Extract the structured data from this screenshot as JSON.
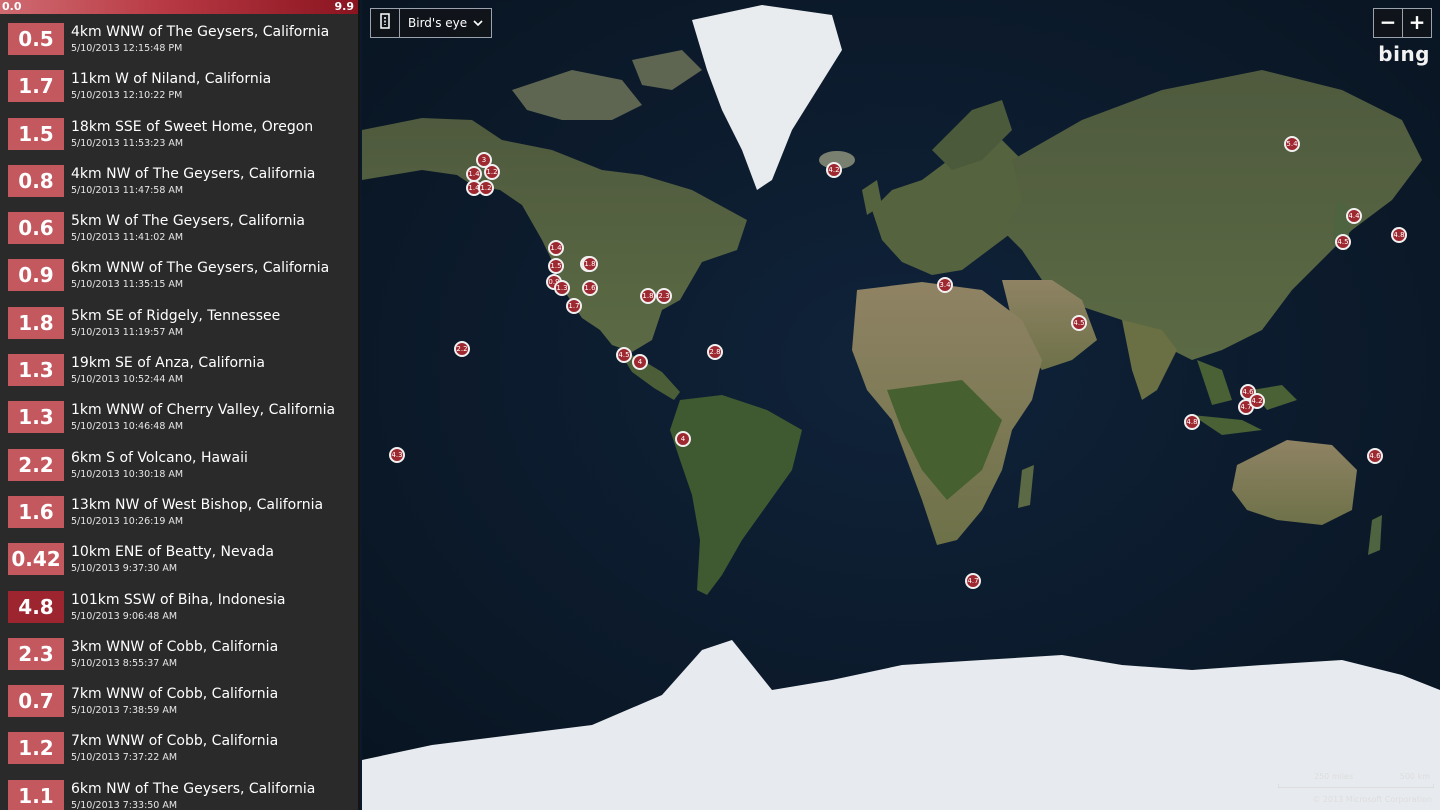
{
  "scale": {
    "min_label": "0.0",
    "max_label": "9.9",
    "colors": [
      "#d06b72",
      "#8a1420"
    ]
  },
  "quakes": [
    {
      "mag": "0.5",
      "place": "4km WNW of The Geysers, California",
      "time": "5/10/2013 12:15:48 PM"
    },
    {
      "mag": "1.7",
      "place": "11km W of Niland, California",
      "time": "5/10/2013 12:10:22 PM"
    },
    {
      "mag": "1.5",
      "place": "18km SSE of Sweet Home, Oregon",
      "time": "5/10/2013 11:53:23 AM"
    },
    {
      "mag": "0.8",
      "place": "4km NW of The Geysers, California",
      "time": "5/10/2013 11:47:58 AM"
    },
    {
      "mag": "0.6",
      "place": "5km W of The Geysers, California",
      "time": "5/10/2013 11:41:02 AM"
    },
    {
      "mag": "0.9",
      "place": "6km WNW of The Geysers, California",
      "time": "5/10/2013 11:35:15 AM"
    },
    {
      "mag": "1.8",
      "place": "5km SE of Ridgely, Tennessee",
      "time": "5/10/2013 11:19:57 AM"
    },
    {
      "mag": "1.3",
      "place": "19km SE of Anza, California",
      "time": "5/10/2013 10:52:44 AM"
    },
    {
      "mag": "1.3",
      "place": "1km WNW of Cherry Valley, California",
      "time": "5/10/2013 10:46:48 AM"
    },
    {
      "mag": "2.2",
      "place": "6km S of Volcano, Hawaii",
      "time": "5/10/2013 10:30:18 AM"
    },
    {
      "mag": "1.6",
      "place": "13km NW of West Bishop, California",
      "time": "5/10/2013 10:26:19 AM"
    },
    {
      "mag": "0.42",
      "place": "10km ENE of Beatty, Nevada",
      "time": "5/10/2013 9:37:30 AM"
    },
    {
      "mag": "4.8",
      "place": "101km SSW of Biha, Indonesia",
      "time": "5/10/2013 9:06:48 AM"
    },
    {
      "mag": "2.3",
      "place": "3km WNW of Cobb, California",
      "time": "5/10/2013 8:55:37 AM"
    },
    {
      "mag": "0.7",
      "place": "7km WNW of Cobb, California",
      "time": "5/10/2013 7:38:59 AM"
    },
    {
      "mag": "1.2",
      "place": "7km WNW of Cobb, California",
      "time": "5/10/2013 7:37:22 AM"
    },
    {
      "mag": "1.1",
      "place": "6km NW of The Geysers, California",
      "time": "5/10/2013 7:33:50 AM"
    }
  ],
  "map": {
    "view_label": "Bird's eye",
    "view_icon": "map-layers-icon",
    "zoom_out_label": "−",
    "zoom_in_label": "+",
    "brand": "bing",
    "scale_label_1": "250 miles",
    "scale_label_2": "500 km",
    "copyright": "© 2013 Microsoft Corporation",
    "marker_color": "#9e2830",
    "markers": [
      {
        "label": "1.4"
      },
      {
        "label": "1.2"
      },
      {
        "label": "1.4"
      },
      {
        "label": "1.2"
      },
      {
        "label": "3"
      },
      {
        "label": "4.2"
      },
      {
        "label": "5.4"
      },
      {
        "label": "4.4"
      },
      {
        "label": "4.5"
      },
      {
        "label": "4.8"
      },
      {
        "label": "1.4"
      },
      {
        "label": "1.5"
      },
      {
        "label": "1.8"
      },
      {
        "label": "0.9"
      },
      {
        "label": "1.8"
      },
      {
        "label": "1.3"
      },
      {
        "label": "1.6"
      },
      {
        "label": "1.7"
      },
      {
        "label": "1.8"
      },
      {
        "label": "2.3"
      },
      {
        "label": "2.2"
      },
      {
        "label": "4.5"
      },
      {
        "label": "4"
      },
      {
        "label": "2.8"
      },
      {
        "label": "4"
      },
      {
        "label": "3.4"
      },
      {
        "label": "4.5"
      },
      {
        "label": "4.6"
      },
      {
        "label": "4.7"
      },
      {
        "label": "4.2"
      },
      {
        "label": "4.8"
      },
      {
        "label": "4.6"
      },
      {
        "label": "4.3"
      },
      {
        "label": "4.7"
      }
    ]
  }
}
